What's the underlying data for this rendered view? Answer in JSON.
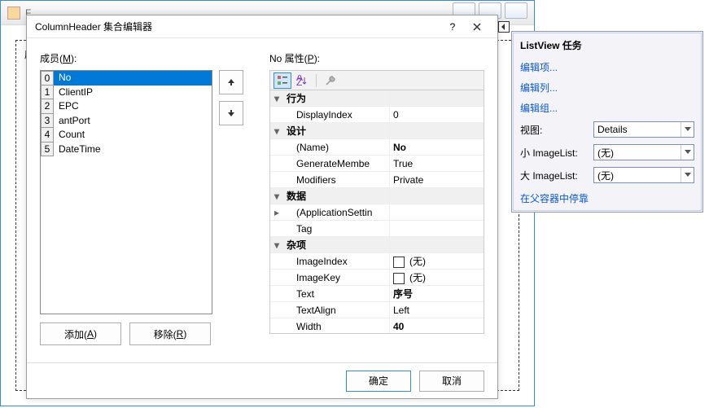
{
  "bg": {
    "label": "序"
  },
  "dialog": {
    "title": "ColumnHeader 集合编辑器",
    "help_tooltip": "?",
    "members_label_pre": "成员(",
    "members_label_key": "M",
    "members_label_post": "):",
    "props_label_pre": "No 属性(",
    "props_label_key": "P",
    "props_label_post": "):",
    "add_pre": "添加(",
    "add_key": "A",
    "add_post": ")",
    "remove_pre": "移除(",
    "remove_key": "R",
    "remove_post": ")",
    "ok": "确定",
    "cancel": "取消",
    "members": [
      {
        "index": "0",
        "name": "No",
        "selected": true
      },
      {
        "index": "1",
        "name": "ClientIP"
      },
      {
        "index": "2",
        "name": "EPC"
      },
      {
        "index": "3",
        "name": "antPort"
      },
      {
        "index": "4",
        "name": "Count"
      },
      {
        "index": "5",
        "name": "DateTime"
      }
    ],
    "categories": {
      "behavior": {
        "label": "行为",
        "DisplayIndex": "0"
      },
      "design": {
        "label": "设计",
        "Name": "No",
        "GenerateMember": "True",
        "Modifiers": "Private",
        "name_key_full": "(Name)",
        "genmember_key_disp": "GenerateMembe"
      },
      "data": {
        "label": "数据",
        "AppSettings_key_disp": "(ApplicationSettin",
        "Tag_key": "Tag"
      },
      "misc": {
        "label": "杂项",
        "ImageIndex_key": "ImageIndex",
        "ImageIndex": "(无)",
        "ImageKey_key": "ImageKey",
        "ImageKey": "(无)",
        "Text_key": "Text",
        "Text": "序号",
        "TextAlign_key": "TextAlign",
        "TextAlign": "Left",
        "Width_key": "Width",
        "Width": "40"
      }
    }
  },
  "tasks": {
    "title": "ListView 任务",
    "edit_items": "编辑项...",
    "edit_columns": "编辑列...",
    "edit_groups": "编辑组...",
    "view_label": "视图:",
    "view_value": "Details",
    "small_il_label": "小 ImageList:",
    "small_il_value": "(无)",
    "large_il_label": "大 ImageList:",
    "large_il_value": "(无)",
    "dock_parent": "在父容器中停靠"
  }
}
